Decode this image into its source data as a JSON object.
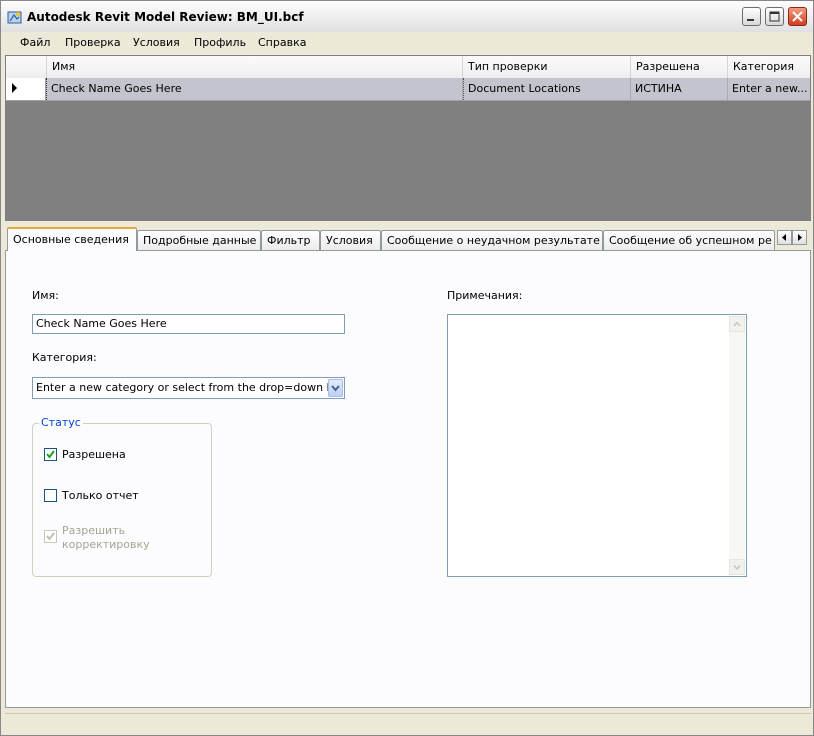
{
  "window": {
    "title": "Autodesk Revit Model Review: BM_UI.bcf"
  },
  "menu": [
    "Файл",
    "Проверка",
    "Условия",
    "Профиль",
    "Справка"
  ],
  "grid": {
    "columns": [
      "Имя",
      "Тип проверки",
      "Разрешена",
      "Категория"
    ],
    "rows": [
      [
        "Check Name Goes Here",
        "Document Locations",
        "ИСТИНА",
        "Enter a new..."
      ]
    ]
  },
  "tabs": [
    "Основные сведения",
    "Подробные данные",
    "Фильтр",
    "Условия",
    "Сообщение о неудачном результате",
    "Сообщение об успешном ре"
  ],
  "form": {
    "name_label": "Имя:",
    "name_value": "Check Name Goes Here",
    "category_label": "Категория:",
    "category_value": "Enter a new category or select from the drop=down li",
    "status_title": "Статус",
    "checks": [
      {
        "label": "Разрешена",
        "checked": true,
        "enabled": true
      },
      {
        "label": "Только отчет",
        "checked": false,
        "enabled": true
      },
      {
        "label_line1": "Разрешить",
        "label_line2": "корректировку",
        "checked": true,
        "enabled": false
      }
    ],
    "notes_label": "Примечания:",
    "notes_value": ""
  },
  "colors": {
    "selected_row": "#c4c4ce",
    "grid_background": "#808080",
    "active_tab_accent": "#e8a53b",
    "group_title": "#0046d5"
  }
}
